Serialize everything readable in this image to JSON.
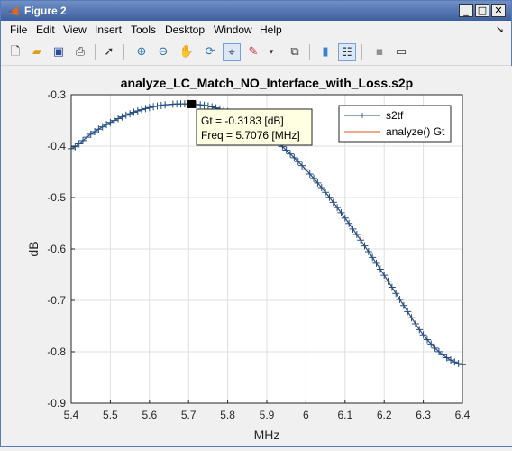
{
  "window": {
    "title": "Figure 2"
  },
  "menu": [
    "File",
    "Edit",
    "View",
    "Insert",
    "Tools",
    "Desktop",
    "Window",
    "Help"
  ],
  "toolbar_icons": [
    "new-figure-icon",
    "open-icon",
    "save-icon",
    "print-icon",
    "pointer-icon",
    "zoom-in-icon",
    "zoom-out-icon",
    "pan-icon",
    "rotate-icon",
    "data-cursor-icon",
    "brush-icon",
    "link-plot-icon",
    "colorbar-icon",
    "legend-icon",
    "hide-plot-tools-icon",
    "show-plot-tools-icon"
  ],
  "chart_data": {
    "type": "line",
    "title": "analyze_LC_Match_NO_Interface_with_Loss.s2p",
    "xlabel": "MHz",
    "ylabel": "dB",
    "xlim": [
      5.4,
      6.4
    ],
    "ylim": [
      -0.9,
      -0.3
    ],
    "xticks": [
      "5.4",
      "5.5",
      "5.6",
      "5.7",
      "5.8",
      "5.9",
      "6",
      "6.1",
      "6.2",
      "6.3",
      "6.4"
    ],
    "yticks": [
      "-0.3",
      "-0.4",
      "-0.5",
      "-0.6",
      "-0.7",
      "-0.8",
      "-0.9"
    ],
    "grid": true,
    "legend_position": "top-right",
    "series": [
      {
        "name": "s2tf",
        "color": "#1f4f8a",
        "marker": "+",
        "x": [
          5.4,
          5.45,
          5.5,
          5.55,
          5.6,
          5.65,
          5.7,
          5.75,
          5.8,
          5.85,
          5.9,
          5.95,
          6.0,
          6.05,
          6.1,
          6.15,
          6.2,
          6.25,
          6.3,
          6.35,
          6.4
        ],
        "y": [
          -0.405,
          -0.377,
          -0.354,
          -0.337,
          -0.325,
          -0.319,
          -0.318,
          -0.322,
          -0.333,
          -0.351,
          -0.376,
          -0.408,
          -0.446,
          -0.49,
          -0.54,
          -0.594,
          -0.651,
          -0.71,
          -0.767,
          -0.806,
          -0.825
        ]
      },
      {
        "name": "analyze() Gt",
        "color": "#d9541a",
        "marker": "",
        "x": [
          5.4,
          5.45,
          5.5,
          5.55,
          5.6,
          5.65,
          5.7,
          5.75,
          5.8,
          5.85,
          5.9,
          5.95,
          6.0,
          6.05,
          6.1,
          6.15,
          6.2,
          6.25,
          6.3,
          6.35,
          6.4
        ],
        "y": [
          -0.405,
          -0.377,
          -0.354,
          -0.337,
          -0.325,
          -0.319,
          -0.318,
          -0.322,
          -0.333,
          -0.351,
          -0.376,
          -0.408,
          -0.446,
          -0.49,
          -0.54,
          -0.594,
          -0.651,
          -0.71,
          -0.767,
          -0.806,
          -0.825
        ]
      }
    ],
    "datatip": {
      "x": 5.7076,
      "y": -0.3183,
      "line1": "Gt = -0.3183 [dB]",
      "line2": "Freq = 5.7076 [MHz]"
    }
  }
}
